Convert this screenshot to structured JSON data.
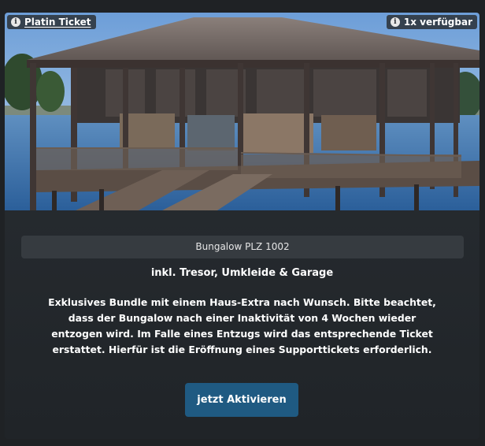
{
  "ticket": {
    "tier_label": "Platin Ticket",
    "availability": "1x verfügbar"
  },
  "property": {
    "name": "Bungalow PLZ 1002",
    "extras": "inkl. Tresor, Umkleide & Garage",
    "description": "Exklusives Bundle mit einem Haus-Extra nach Wunsch. Bitte beachtet, dass der Bungalow nach einer Inaktivität von 4 Wochen wieder entzogen wird. Im Falle eines Entzugs wird das entsprechende Ticket erstattet. Hierfür ist die Eröffnung eines Supporttickets erforderlich."
  },
  "actions": {
    "activate_label": "jetzt Aktivieren"
  },
  "icons": {
    "info": "info-icon"
  },
  "colors": {
    "button": "#1f5a82",
    "card_background": "#2a2f34"
  }
}
